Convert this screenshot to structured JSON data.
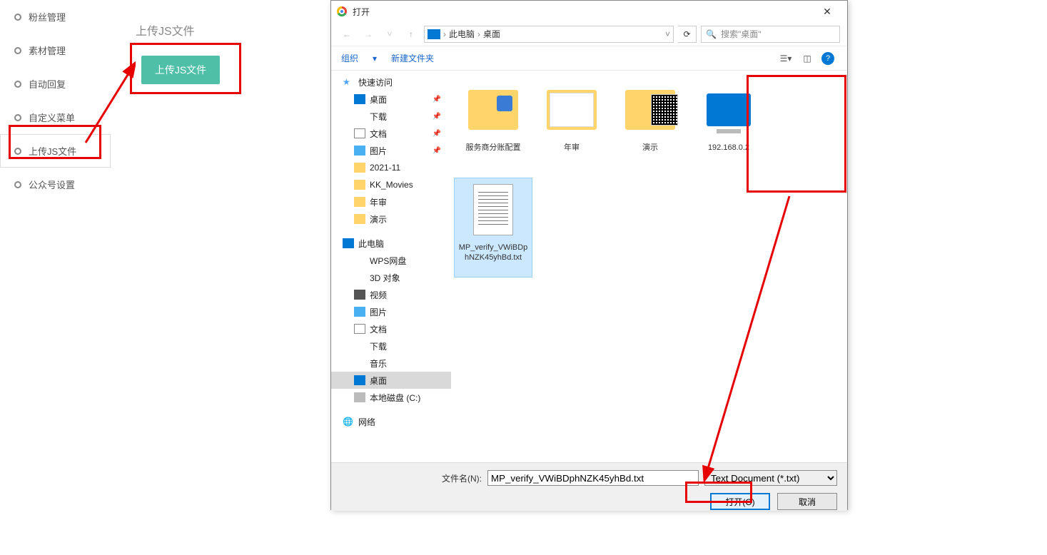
{
  "sidebar": {
    "items": [
      {
        "label": "粉丝管理"
      },
      {
        "label": "素材管理"
      },
      {
        "label": "自动回复"
      },
      {
        "label": "自定义菜单"
      },
      {
        "label": "上传JS文件"
      },
      {
        "label": "公众号设置"
      }
    ]
  },
  "main": {
    "title": "上传JS文件",
    "upload_button": "上传JS文件"
  },
  "dialog": {
    "title": "打开",
    "path": {
      "root": "此电脑",
      "folder": "桌面"
    },
    "search_placeholder": "搜索\"桌面\"",
    "toolbar": {
      "organize": "组织",
      "newfolder": "新建文件夹"
    },
    "tree": {
      "quick": "快速访问",
      "quick_items": [
        {
          "label": "桌面",
          "pinned": true,
          "ico": "ico-desk"
        },
        {
          "label": "下载",
          "pinned": true,
          "ico": "ico-down"
        },
        {
          "label": "文档",
          "pinned": true,
          "ico": "ico-doc"
        },
        {
          "label": "图片",
          "pinned": true,
          "ico": "ico-pic"
        },
        {
          "label": "2021-11",
          "ico": "ico-folder"
        },
        {
          "label": "KK_Movies",
          "ico": "ico-folder"
        },
        {
          "label": "年审",
          "ico": "ico-folder"
        },
        {
          "label": "演示",
          "ico": "ico-folder"
        }
      ],
      "pc": "此电脑",
      "pc_items": [
        {
          "label": "WPS网盘",
          "ico": "ico-cloud"
        },
        {
          "label": "3D 对象",
          "ico": "ico-3d"
        },
        {
          "label": "视频",
          "ico": "ico-vid"
        },
        {
          "label": "图片",
          "ico": "ico-pic"
        },
        {
          "label": "文档",
          "ico": "ico-doc"
        },
        {
          "label": "下载",
          "ico": "ico-down"
        },
        {
          "label": "音乐",
          "ico": "ico-mus"
        },
        {
          "label": "桌面",
          "ico": "ico-desk",
          "sel": true
        },
        {
          "label": "本地磁盘 (C:)",
          "ico": "ico-disk"
        }
      ],
      "network": "网络"
    },
    "files": [
      {
        "name": "服务商分账配置",
        "type": "folder-app"
      },
      {
        "name": "年审",
        "type": "folder-img"
      },
      {
        "name": "演示",
        "type": "folder-qr"
      },
      {
        "name": "192.168.0.2",
        "type": "monitor"
      },
      {
        "name": "MP_verify_VWiBDphNZK45yhBd.txt",
        "type": "txt",
        "selected": true
      }
    ],
    "bottom": {
      "filename_label": "文件名(N):",
      "filename_value": "MP_verify_VWiBDphNZK45yhBd.txt",
      "filetype": "Text Document (*.txt)",
      "open": "打开(O)",
      "cancel": "取消"
    }
  }
}
